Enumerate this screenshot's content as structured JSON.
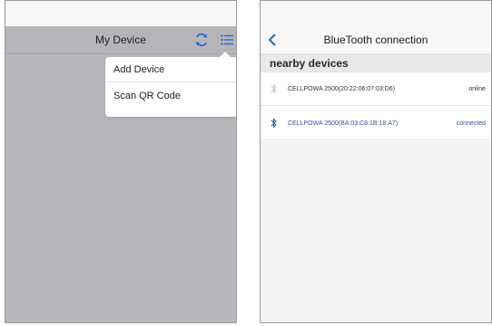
{
  "left": {
    "title": "My Device",
    "menu": [
      "Add Device",
      "Scan QR Code"
    ]
  },
  "right": {
    "title": "BlueTooth connection",
    "section": "nearby devices",
    "devices": [
      {
        "name": "CELLPOWA 2500(20:22:06:07:03:D6)",
        "status": "online"
      },
      {
        "name": "CELLPOWA 2500(BA:03:C8:1B:18:A7)",
        "status": "connected"
      }
    ]
  },
  "colors": {
    "overlay_gray": "#b8b8bc",
    "accent_blue": "#2f5597",
    "icon_blue": "#2a66c8"
  },
  "icons": [
    "refresh-icon",
    "menu-list-icon",
    "back-chevron-icon",
    "bluetooth-icon"
  ]
}
